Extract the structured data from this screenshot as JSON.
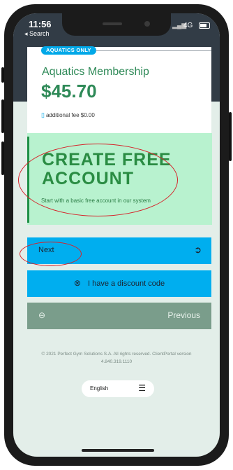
{
  "status_bar": {
    "time": "11:56",
    "back_label": "◂ Search",
    "network": "4G"
  },
  "card": {
    "badge": "AQUATICS ONLY",
    "title": "Aquatics Membership",
    "price": "$45.70",
    "fee_text": "additional fee $0.00"
  },
  "promo": {
    "title": "CREATE FREE ACCOUNT",
    "subtitle": "Start with a basic free account in our system"
  },
  "buttons": {
    "next_label": "Next",
    "discount_label": "I have a discount code",
    "previous_label": "Previous"
  },
  "footer": {
    "copyright": "© 2021 Perfect Gym Solutions S.A. All rights reserved. ClientPortal version 4.840.319.1110"
  },
  "language": {
    "label": "English"
  },
  "colors": {
    "accent_blue": "#00aeef",
    "brand_green": "#2f8a58",
    "annotation_red": "#d6232a"
  }
}
